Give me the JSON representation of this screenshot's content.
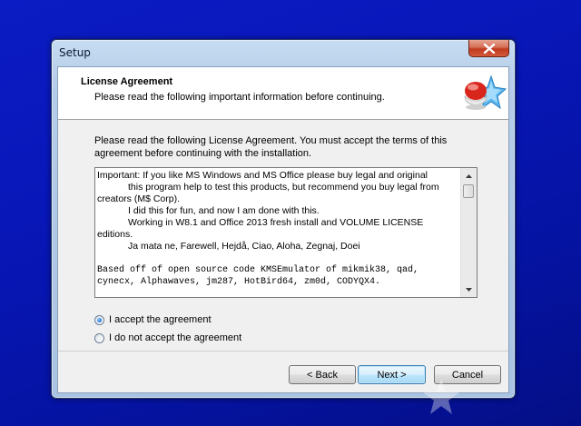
{
  "window": {
    "title": "Setup"
  },
  "header": {
    "title": "License Agreement",
    "subtitle": "Please read the following important information before continuing."
  },
  "intro": {
    "text": "Please read the following License Agreement. You must accept the terms of this agreement before continuing with the installation."
  },
  "license": {
    "lines": [
      "Important: If you like MS Windows and MS Office please buy legal and original",
      "this program help to test this products, but recommend you buy legal from",
      "creators (M$ Corp).",
      "I did this for fun, and now I am done with this.",
      "Working in W8.1 and Office 2013 fresh install and VOLUME LICENSE",
      "editions.",
      "Ja mata ne, Farewell, Hejdå, Ciao, Aloha, Zegnaj, Doei",
      "Based off of open source code KMSEmulator of mikmik38, qad,",
      "cynecx, Alphawaves, jm287, HotBird64, zm0d, CODYQX4."
    ]
  },
  "options": {
    "accept_label": "I accept the agreement",
    "decline_label": "I do not accept the agreement",
    "selected": "accept"
  },
  "buttons": {
    "back_label": "< Back",
    "next_label": "Next >",
    "cancel_label": "Cancel"
  },
  "colors": {
    "desktop": "#0817b8",
    "accent_blue": "#3c7fb1",
    "close_red": "#c0391f"
  },
  "icons": {
    "header": "setup-wizard-icon",
    "close": "close-icon"
  }
}
